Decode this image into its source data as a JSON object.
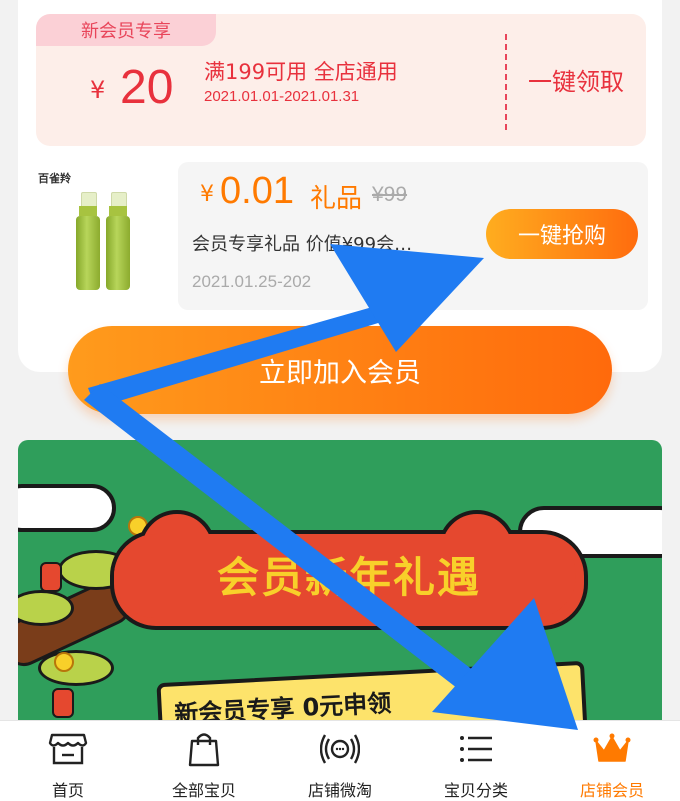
{
  "coupon": {
    "tag": "新会员专享",
    "currency": "¥",
    "amount": "20",
    "condition": "满199可用 全店通用",
    "validity": "2021.01.01-2021.01.31",
    "claim_label": "一键领取"
  },
  "gift": {
    "brand": "百雀羚",
    "currency": "¥",
    "price": "0.01",
    "type": "礼品",
    "original_price": "¥99",
    "description": "会员专享礼品 价值¥99会…",
    "validity": "2021.01.25-202",
    "buy_label": "一键抢购"
  },
  "join_label": "立即加入会员",
  "banner": {
    "title": "会员新年礼遇",
    "ribbon": "新会员专享 0元申领"
  },
  "nav": {
    "items": [
      {
        "label": "首页",
        "icon": "storefront-icon"
      },
      {
        "label": "全部宝贝",
        "icon": "shopping-bag-icon"
      },
      {
        "label": "店铺微淘",
        "icon": "broadcast-icon"
      },
      {
        "label": "宝贝分类",
        "icon": "list-icon"
      },
      {
        "label": "店铺会员",
        "icon": "crown-icon"
      }
    ],
    "active_index": 4
  },
  "colors": {
    "coupon_red": "#e8313d",
    "accent_orange": "#ff7a00",
    "banner_green": "#2f9e5b",
    "arrow_blue": "#1f7bf2"
  }
}
